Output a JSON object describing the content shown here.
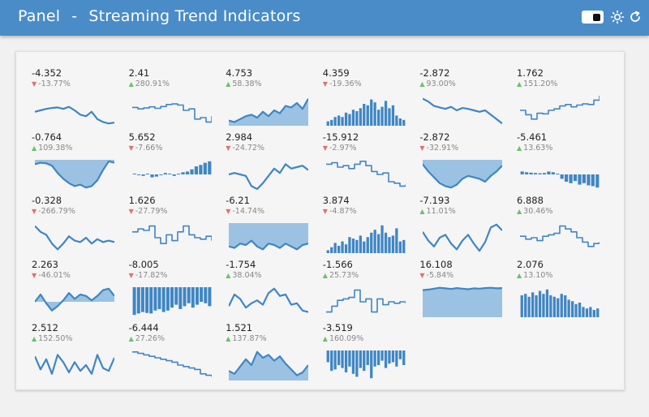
{
  "header": {
    "title": "Panel",
    "separator": "-",
    "subtitle": "Streaming Trend Indicators",
    "background": "#4a8cc7"
  },
  "controls": {
    "theme_toggle_icon": "toggle-switch-icon",
    "theme_icon": "sun-icon",
    "reload_icon": "reload-icon"
  },
  "colors": {
    "line": "#3f86c4",
    "area_fill": "#9bc2e2",
    "bar": "#3f86c4",
    "up": "#6cc06c",
    "down": "#e07070"
  },
  "indicators": [
    {
      "value": "-4.352",
      "change": "-13.77%",
      "dir": "down",
      "type": "line",
      "data": [
        0.45,
        0.5,
        0.55,
        0.58,
        0.6,
        0.55,
        0.62,
        0.5,
        0.35,
        0.3,
        0.45,
        0.2,
        0.1,
        0.05,
        0.08
      ]
    },
    {
      "value": "2.41",
      "change": "280.91%",
      "dir": "up",
      "type": "step",
      "data": [
        0.6,
        0.55,
        0.58,
        0.62,
        0.57,
        0.63,
        0.7,
        0.72,
        0.68,
        0.5,
        0.55,
        0.2,
        0.25,
        0.1,
        0.3
      ]
    },
    {
      "value": "4.753",
      "change": "58.38%",
      "dir": "up",
      "type": "area",
      "data": [
        0.15,
        0.1,
        0.2,
        0.3,
        0.35,
        0.25,
        0.45,
        0.3,
        0.5,
        0.4,
        0.65,
        0.6,
        0.75,
        0.55,
        0.9
      ]
    },
    {
      "value": "4.359",
      "change": "-19.36%",
      "dir": "down",
      "type": "bar",
      "data": [
        0.15,
        0.2,
        0.3,
        0.35,
        0.3,
        0.45,
        0.4,
        0.55,
        0.5,
        0.6,
        0.75,
        0.7,
        0.9,
        0.8,
        0.55,
        0.65,
        0.85,
        0.6,
        0.7,
        0.35,
        0.25,
        0.2
      ]
    },
    {
      "value": "-2.872",
      "change": "93.00%",
      "dir": "up",
      "type": "line",
      "data": [
        0.9,
        0.8,
        0.65,
        0.6,
        0.55,
        0.62,
        0.5,
        0.58,
        0.55,
        0.5,
        0.45,
        0.5,
        0.35,
        0.2,
        0.05
      ]
    },
    {
      "value": "1.762",
      "change": "151.20%",
      "dir": "up",
      "type": "step",
      "data": [
        0.5,
        0.35,
        0.2,
        0.4,
        0.38,
        0.5,
        0.55,
        0.65,
        0.7,
        0.62,
        0.68,
        0.72,
        0.7,
        0.85,
        1.0
      ]
    },
    {
      "value": "-0.764",
      "change": "109.38%",
      "dir": "up",
      "type": "area-neg",
      "data": [
        0.85,
        0.9,
        0.88,
        0.8,
        0.55,
        0.35,
        0.2,
        0.1,
        0.15,
        0.05,
        0.1,
        0.3,
        0.65,
        0.95,
        0.9
      ]
    },
    {
      "value": "5.652",
      "change": "-7.66%",
      "dir": "down",
      "type": "bar-neg",
      "data": [
        0.0,
        -0.05,
        -0.1,
        0.05,
        -0.2,
        -0.15,
        -0.05,
        0.1,
        0.05,
        -0.1,
        0.05,
        0.15,
        0.2,
        0.35,
        0.55,
        0.65,
        0.8,
        0.9
      ]
    },
    {
      "value": "2.984",
      "change": "-24.72%",
      "dir": "down",
      "type": "line",
      "data": [
        0.5,
        0.55,
        0.5,
        0.45,
        0.1,
        0.0,
        0.2,
        0.45,
        0.7,
        0.55,
        0.85,
        0.7,
        0.75,
        0.8,
        0.65
      ]
    },
    {
      "value": "-15.912",
      "change": "-2.97%",
      "dir": "down",
      "type": "step",
      "data": [
        0.85,
        0.9,
        0.75,
        0.8,
        0.7,
        0.85,
        0.95,
        0.8,
        0.6,
        0.5,
        0.55,
        0.25,
        0.2,
        0.1,
        0.15
      ]
    },
    {
      "value": "-2.872",
      "change": "-32.91%",
      "dir": "down",
      "type": "area-neg",
      "data": [
        0.85,
        0.6,
        0.4,
        0.2,
        0.1,
        0.05,
        0.15,
        0.35,
        0.45,
        0.4,
        0.35,
        0.25,
        0.45,
        0.6,
        0.8
      ]
    },
    {
      "value": "-5.461",
      "change": "13.63%",
      "dir": "up",
      "type": "bar-neg",
      "data": [
        0.2,
        0.15,
        0.12,
        0.1,
        0.08,
        0.1,
        0.2,
        0.15,
        0.05,
        -0.3,
        -0.5,
        -0.6,
        -0.45,
        -0.7,
        -0.6,
        -0.75,
        -0.8,
        -0.9
      ]
    },
    {
      "value": "-0.328",
      "change": "-266.79%",
      "dir": "down",
      "type": "line",
      "data": [
        0.9,
        0.7,
        0.6,
        0.3,
        0.1,
        0.3,
        0.55,
        0.4,
        0.35,
        0.5,
        0.3,
        0.45,
        0.35,
        0.4,
        0.35
      ]
    },
    {
      "value": "1.626",
      "change": "-27.79%",
      "dir": "down",
      "type": "step",
      "data": [
        0.7,
        0.8,
        0.75,
        0.9,
        0.5,
        0.3,
        0.6,
        0.4,
        0.7,
        0.9,
        0.6,
        0.5,
        0.45,
        0.55,
        0.4
      ]
    },
    {
      "value": "-6.21",
      "change": "-14.74%",
      "dir": "down",
      "type": "area-neg",
      "data": [
        0.2,
        0.15,
        0.3,
        0.25,
        0.4,
        0.2,
        0.1,
        0.3,
        0.25,
        0.15,
        0.3,
        0.2,
        0.1,
        0.25,
        0.3
      ]
    },
    {
      "value": "3.874",
      "change": "-4.87%",
      "dir": "down",
      "type": "bar",
      "data": [
        0.1,
        0.2,
        0.35,
        0.25,
        0.4,
        0.3,
        0.55,
        0.5,
        0.45,
        0.6,
        0.4,
        0.55,
        0.7,
        0.8,
        0.65,
        0.95,
        0.7,
        0.55,
        0.6,
        0.85,
        0.4,
        0.45
      ]
    },
    {
      "value": "-7.193",
      "change": "11.01%",
      "dir": "up",
      "type": "line",
      "data": [
        0.7,
        0.4,
        0.2,
        0.5,
        0.6,
        0.3,
        0.1,
        0.4,
        0.6,
        0.3,
        0.05,
        0.35,
        0.85,
        0.95,
        0.75
      ]
    },
    {
      "value": "6.888",
      "change": "30.46%",
      "dir": "up",
      "type": "step",
      "data": [
        0.55,
        0.45,
        0.5,
        0.4,
        0.55,
        0.6,
        0.65,
        0.9,
        0.8,
        0.7,
        0.5,
        0.35,
        0.2,
        0.3,
        0.35
      ]
    },
    {
      "value": "2.263",
      "change": "-46.01%",
      "dir": "down",
      "type": "area-mid",
      "data": [
        0.5,
        0.75,
        0.45,
        0.2,
        0.35,
        0.55,
        0.8,
        0.6,
        0.75,
        0.7,
        0.55,
        0.7,
        0.9,
        0.95,
        0.7
      ]
    },
    {
      "value": "-8.005",
      "change": "-17.82%",
      "dir": "down",
      "type": "bar-neg",
      "data": [
        -0.95,
        -0.9,
        -0.85,
        -0.88,
        -0.9,
        -0.8,
        -0.75,
        -0.85,
        -0.8,
        -0.7,
        -0.6,
        -0.75,
        -0.65,
        -0.55,
        -0.7,
        -0.6,
        -0.5,
        -0.55,
        -0.65
      ]
    },
    {
      "value": "-1.754",
      "change": "38.04%",
      "dir": "up",
      "type": "line",
      "data": [
        0.35,
        0.75,
        0.6,
        0.3,
        0.45,
        0.55,
        0.4,
        0.8,
        0.95,
        0.7,
        0.75,
        0.4,
        0.45,
        0.2,
        0.15
      ]
    },
    {
      "value": "-1.566",
      "change": "25.73%",
      "dir": "up",
      "type": "step",
      "data": [
        0.15,
        0.35,
        0.55,
        0.6,
        0.65,
        0.9,
        0.5,
        0.6,
        0.15,
        0.6,
        0.4,
        0.5,
        0.45,
        0.5,
        0.45
      ]
    },
    {
      "value": "16.108",
      "change": "-5.84%",
      "dir": "down",
      "type": "area",
      "data": [
        0.9,
        0.92,
        0.95,
        0.98,
        0.96,
        0.94,
        0.97,
        0.95,
        0.93,
        0.96,
        0.95,
        0.97,
        0.98,
        0.96,
        0.97
      ]
    },
    {
      "value": "2.076",
      "change": "13.10%",
      "dir": "up",
      "type": "bar",
      "data": [
        0.75,
        0.8,
        0.7,
        0.85,
        0.75,
        0.9,
        0.8,
        0.95,
        0.75,
        0.7,
        0.65,
        0.8,
        0.75,
        0.6,
        0.55,
        0.45,
        0.5,
        0.35,
        0.3,
        0.35,
        0.25,
        0.3
      ]
    },
    {
      "value": "2.512",
      "change": "152.50%",
      "dir": "up",
      "type": "line",
      "data": [
        0.8,
        0.35,
        0.7,
        0.2,
        0.85,
        0.6,
        0.25,
        0.6,
        0.3,
        0.5,
        0.2,
        0.85,
        0.4,
        0.3,
        0.75
      ]
    },
    {
      "value": "-6.444",
      "change": "27.26%",
      "dir": "up",
      "type": "step",
      "data": [
        0.95,
        0.9,
        0.85,
        0.8,
        0.75,
        0.7,
        0.65,
        0.6,
        0.5,
        0.45,
        0.4,
        0.35,
        0.2,
        0.15,
        0.1
      ]
    },
    {
      "value": "1.521",
      "change": "137.87%",
      "dir": "up",
      "type": "area",
      "data": [
        0.3,
        0.2,
        0.45,
        0.7,
        0.5,
        0.95,
        0.75,
        0.85,
        0.65,
        0.8,
        0.55,
        0.35,
        0.15,
        0.25,
        0.5
      ]
    },
    {
      "value": "-3.519",
      "change": "160.09%",
      "dir": "up",
      "type": "bar-neg",
      "data": [
        -0.4,
        -0.7,
        -0.65,
        -0.5,
        -0.6,
        -0.75,
        -0.55,
        -0.8,
        -0.9,
        -0.6,
        -0.7,
        -0.5,
        -0.95,
        -0.55,
        -0.5,
        -0.35,
        -0.6,
        -0.45,
        -0.4,
        -0.55,
        -0.3,
        -0.5
      ]
    }
  ]
}
